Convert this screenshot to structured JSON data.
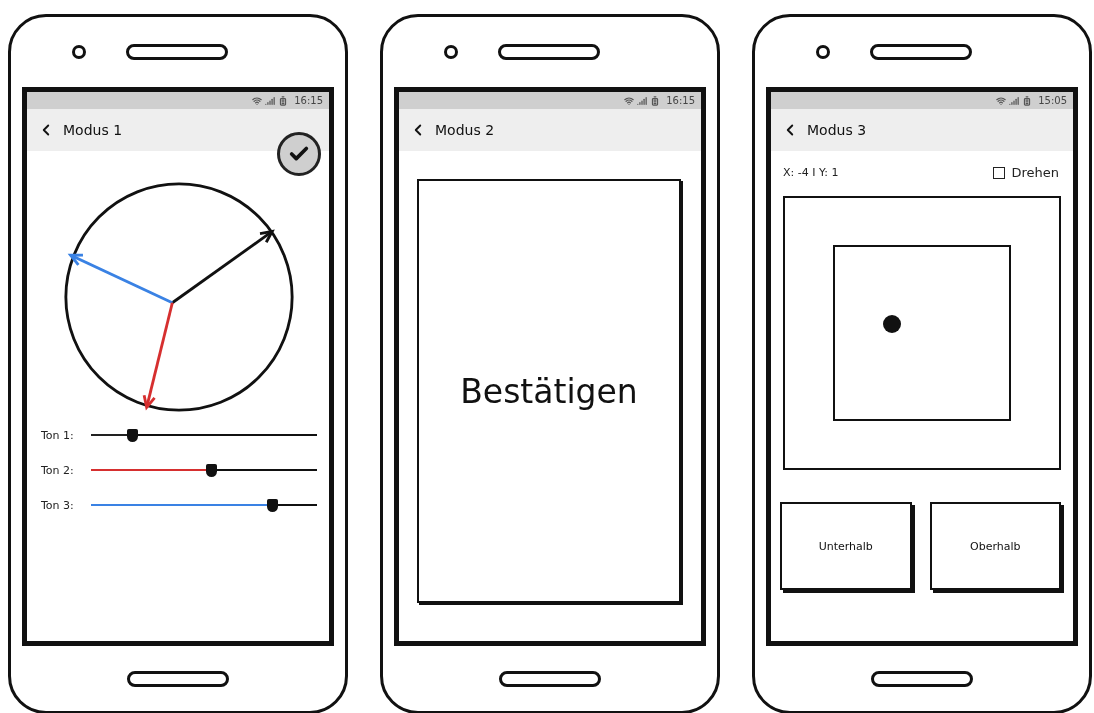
{
  "phones": [
    {
      "kind": "dial",
      "status_time": "16:15",
      "title": "Modus 1",
      "sliders": [
        {
          "label": "Ton 1:",
          "level": 0.18,
          "color": "#222222"
        },
        {
          "label": "Ton 2:",
          "level": 0.53,
          "color": "#d62f2f"
        },
        {
          "label": "Ton 3:",
          "level": 0.8,
          "color": "#3a82e4"
        }
      ]
    },
    {
      "kind": "confirm",
      "status_time": "16:15",
      "title": "Modus 2",
      "button": "Bestätigen"
    },
    {
      "kind": "target",
      "status_time": "15:05",
      "title": "Modus 3",
      "coordinates": "X: -4 I Y: 1",
      "checkbox": {
        "label": "Drehen",
        "checked": false
      },
      "buttons": [
        "Unterhalb",
        "Oberhalb"
      ]
    }
  ]
}
